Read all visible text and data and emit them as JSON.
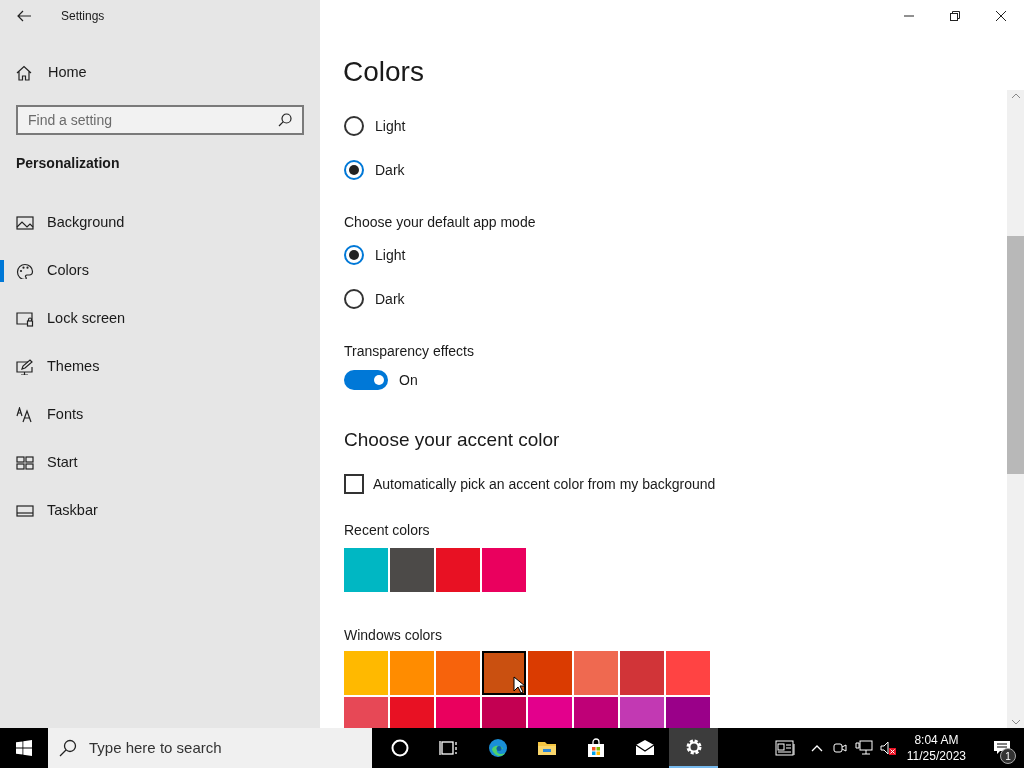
{
  "window": {
    "title": "Settings"
  },
  "sidebar": {
    "home": "Home",
    "search": {
      "placeholder": "Find a setting"
    },
    "section": "Personalization",
    "items": [
      {
        "label": "Background",
        "kind": "background",
        "selected": false
      },
      {
        "label": "Colors",
        "kind": "colors",
        "selected": true
      },
      {
        "label": "Lock screen",
        "kind": "lock",
        "selected": false
      },
      {
        "label": "Themes",
        "kind": "themes",
        "selected": false
      },
      {
        "label": "Fonts",
        "kind": "fonts",
        "selected": false
      },
      {
        "label": "Start",
        "kind": "start",
        "selected": false
      },
      {
        "label": "Taskbar",
        "kind": "taskbar",
        "selected": false
      }
    ]
  },
  "page_title": "Colors",
  "windows_mode": [
    {
      "label": "Light",
      "selected": false
    },
    {
      "label": "Dark",
      "selected": true
    }
  ],
  "app_mode": {
    "label": "Choose your default app mode",
    "options": [
      {
        "label": "Light",
        "selected": true
      },
      {
        "label": "Dark",
        "selected": false
      }
    ]
  },
  "transparency": {
    "label": "Transparency effects",
    "on": true,
    "state": "On"
  },
  "accent": {
    "heading": "Choose your accent color",
    "auto_pick": {
      "label": "Automatically pick an accent color from my background",
      "checked": false
    },
    "recent_label": "Recent colors",
    "recent": [
      {
        "color": "#00b7c3"
      },
      {
        "color": "#4c4a48"
      },
      {
        "color": "#e81123"
      },
      {
        "color": "#ea005e"
      }
    ],
    "windows_label": "Windows colors",
    "windows": [
      {
        "color": "#ffb900",
        "selected": false
      },
      {
        "color": "#ff8c00",
        "selected": false
      },
      {
        "color": "#f7630c",
        "selected": false
      },
      {
        "color": "#ca5010",
        "selected": true
      },
      {
        "color": "#da3b01",
        "selected": false
      },
      {
        "color": "#ef6950",
        "selected": false
      },
      {
        "color": "#d13438",
        "selected": false
      },
      {
        "color": "#ff4343",
        "selected": false
      },
      {
        "color": "#e74856",
        "selected": false
      },
      {
        "color": "#e81123",
        "selected": false
      },
      {
        "color": "#ea005e",
        "selected": false
      },
      {
        "color": "#c30052",
        "selected": false
      },
      {
        "color": "#e3008c",
        "selected": false
      },
      {
        "color": "#bf0077",
        "selected": false
      },
      {
        "color": "#c239b3",
        "selected": false
      },
      {
        "color": "#9a0089",
        "selected": false
      }
    ]
  },
  "taskbar": {
    "search": {
      "placeholder": "Type here to search"
    },
    "apps": [
      {
        "kind": "cortana",
        "selected": false
      },
      {
        "kind": "taskview",
        "selected": false
      },
      {
        "kind": "edge",
        "selected": false
      },
      {
        "kind": "explorer",
        "selected": false
      },
      {
        "kind": "store",
        "selected": false
      },
      {
        "kind": "mail",
        "selected": false
      },
      {
        "kind": "settings",
        "selected": true
      }
    ],
    "time": "8:04 AM",
    "date": "11/25/2023",
    "notifications": "1"
  }
}
